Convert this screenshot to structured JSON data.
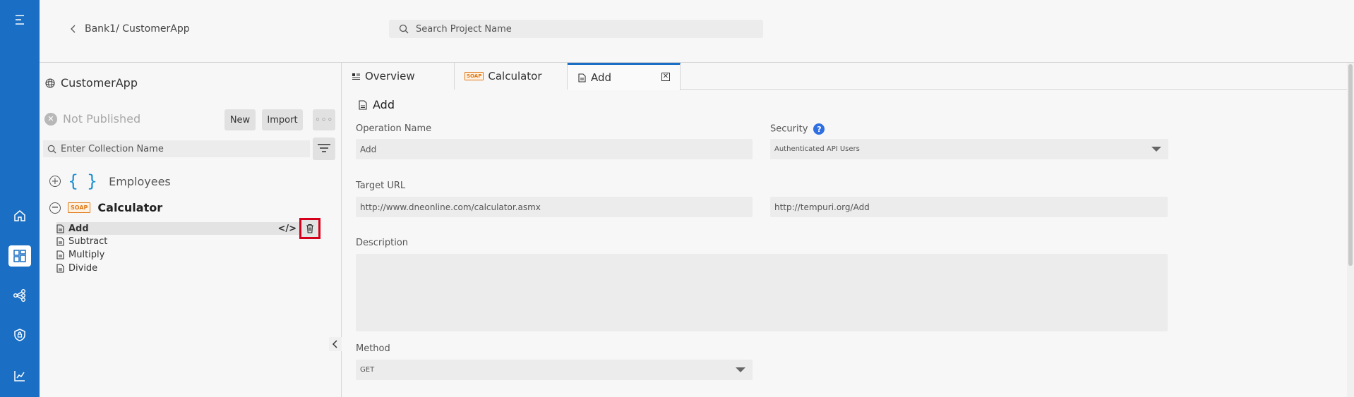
{
  "header": {
    "breadcrumb": "Bank1/ CustomerApp",
    "search_placeholder": "Search Project Name"
  },
  "panel": {
    "project_title": "CustomerApp",
    "status": "Not Published",
    "new_label": "New",
    "import_label": "Import",
    "more_label": "◦◦◦",
    "collection_placeholder": "Enter Collection Name",
    "collections": [
      {
        "name": "Employees",
        "expanded": false
      },
      {
        "name": "Calculator",
        "badge": "SOAP",
        "expanded": true
      }
    ],
    "operations": [
      "Add",
      "Subtract",
      "Multiply",
      "Divide"
    ],
    "code_icon_label": "</>"
  },
  "tabs": [
    {
      "label": "Overview"
    },
    {
      "label": "Calculator",
      "badge": "SOAP"
    },
    {
      "label": "Add",
      "active": true
    }
  ],
  "form": {
    "title": "Add",
    "operation_name_label": "Operation Name",
    "operation_name_value": "Add",
    "security_label": "Security",
    "security_help": "?",
    "security_value": "Authenticated API Users",
    "target_url_label": "Target URL",
    "target_url_value": "http://www.dneonline.com/calculator.asmx",
    "soap_action_value": "http://tempuri.org/Add",
    "description_label": "Description",
    "description_value": "",
    "method_label": "Method",
    "method_value": "GET"
  },
  "colors": {
    "rail": "#1a6fc4",
    "accent": "#1a6fc4",
    "delete_highlight": "#d5001c",
    "soap_badge": "#e07b1a",
    "help_badge": "#2f6fe0"
  }
}
